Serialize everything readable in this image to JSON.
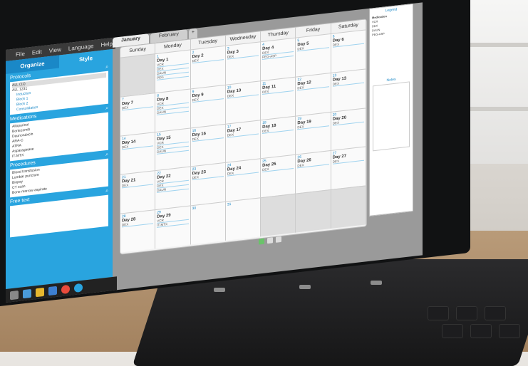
{
  "menu": {
    "items": [
      "File",
      "Edit",
      "View",
      "Language",
      "Help"
    ]
  },
  "left_panel": {
    "tabs": [
      "Organize",
      "Style"
    ],
    "protocols_title": "Protocols",
    "protocols": [
      "ALL (11)",
      "ALL 1231"
    ],
    "protocol_options": [
      "Induction",
      "Block 1",
      "Block 2",
      "Consolidation"
    ],
    "medications_title": "Medications",
    "medications": [
      "Allopurinol",
      "Bortezomib",
      "Daunorubicin",
      "ARA-C",
      "ATRA",
      "Asparaginase",
      "IT-MTX"
    ],
    "procedures_title": "Procedures",
    "procedures": [
      "Blood transfusion",
      "Lumbar puncture",
      "Biopsy",
      "CT scan",
      "Bone marrow aspirate"
    ],
    "freetext_title": "Free text"
  },
  "month_tabs": [
    "January",
    "February",
    "+"
  ],
  "calendar": {
    "weekdays": [
      "Sunday",
      "Monday",
      "Tuesday",
      "Wednesday",
      "Thursday",
      "Friday",
      "Saturday"
    ],
    "weeks": [
      [
        {
          "n": "",
          "day": "",
          "e": []
        },
        {
          "n": "1",
          "day": "Day 1",
          "e": [
            "VCR",
            "DEX",
            "DAUN",
            "PEG"
          ]
        },
        {
          "n": "2",
          "day": "Day 2",
          "e": [
            "DEX"
          ]
        },
        {
          "n": "3",
          "day": "Day 3",
          "e": [
            "DEX"
          ]
        },
        {
          "n": "4",
          "day": "Day 4",
          "e": [
            "DEX",
            "PEG-ASP"
          ]
        },
        {
          "n": "5",
          "day": "Day 5",
          "e": [
            "DEX"
          ]
        },
        {
          "n": "6",
          "day": "Day 6",
          "e": [
            "DEX"
          ]
        }
      ],
      [
        {
          "n": "7",
          "day": "Day 7",
          "e": [
            "DEX"
          ]
        },
        {
          "n": "8",
          "day": "Day 8",
          "e": [
            "VCR",
            "DEX",
            "DAUN"
          ]
        },
        {
          "n": "9",
          "day": "Day 9",
          "e": [
            "DEX"
          ]
        },
        {
          "n": "10",
          "day": "Day 10",
          "e": [
            "DEX"
          ]
        },
        {
          "n": "11",
          "day": "Day 11",
          "e": [
            "DEX"
          ]
        },
        {
          "n": "12",
          "day": "Day 12",
          "e": [
            "DEX"
          ]
        },
        {
          "n": "13",
          "day": "Day 13",
          "e": [
            "DEX"
          ]
        }
      ],
      [
        {
          "n": "14",
          "day": "Day 14",
          "e": [
            "DEX"
          ]
        },
        {
          "n": "15",
          "day": "Day 15",
          "e": [
            "VCR",
            "DEX",
            "DAUN"
          ]
        },
        {
          "n": "16",
          "day": "Day 16",
          "e": [
            "DEX"
          ]
        },
        {
          "n": "17",
          "day": "Day 17",
          "e": [
            "DEX"
          ]
        },
        {
          "n": "18",
          "day": "Day 18",
          "e": [
            "DEX"
          ]
        },
        {
          "n": "19",
          "day": "Day 19",
          "e": [
            "DEX"
          ]
        },
        {
          "n": "20",
          "day": "Day 20",
          "e": [
            "DEX"
          ]
        }
      ],
      [
        {
          "n": "21",
          "day": "Day 21",
          "e": [
            "DEX"
          ]
        },
        {
          "n": "22",
          "day": "Day 22",
          "e": [
            "VCR",
            "DEX",
            "DAUN"
          ]
        },
        {
          "n": "23",
          "day": "Day 23",
          "e": [
            "DEX"
          ]
        },
        {
          "n": "24",
          "day": "Day 24",
          "e": [
            "DEX"
          ]
        },
        {
          "n": "25",
          "day": "Day 25",
          "e": [
            "DEX"
          ]
        },
        {
          "n": "26",
          "day": "Day 26",
          "e": [
            "DEX"
          ]
        },
        {
          "n": "27",
          "day": "Day 27",
          "e": [
            "DEX"
          ]
        }
      ],
      [
        {
          "n": "28",
          "day": "Day 28",
          "e": [
            "DEX"
          ]
        },
        {
          "n": "29",
          "day": "Day 29",
          "e": [
            "VCR",
            "IT-MTX"
          ]
        },
        {
          "n": "30",
          "day": "",
          "e": []
        },
        {
          "n": "31",
          "day": "",
          "e": []
        },
        {
          "n": "",
          "day": "",
          "e": []
        },
        {
          "n": "",
          "day": "",
          "e": []
        },
        {
          "n": "",
          "day": "",
          "e": []
        }
      ]
    ]
  },
  "legend": {
    "title": "Legend",
    "items": [
      "Medication",
      "VCR",
      "DEX",
      "DAUN",
      "PEG-ASP"
    ],
    "notes_title": "Notes"
  }
}
